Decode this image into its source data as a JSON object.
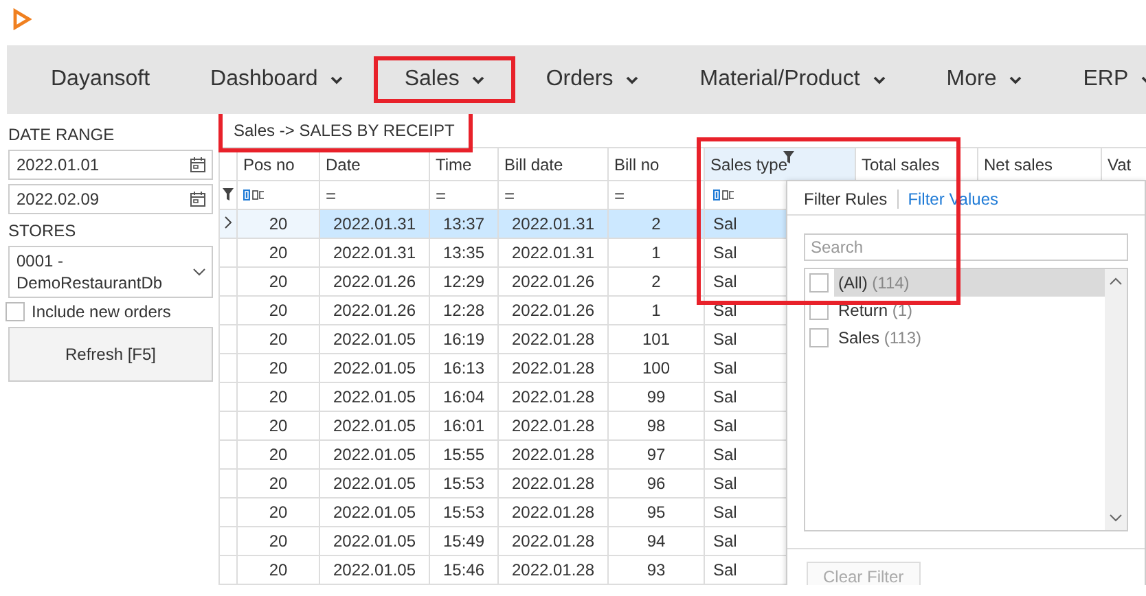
{
  "nav": [
    {
      "label": "Dayansoft",
      "dropdown": false,
      "highlighted": false
    },
    {
      "label": "Dashboard",
      "dropdown": true,
      "highlighted": false
    },
    {
      "label": "Sales",
      "dropdown": true,
      "highlighted": true
    },
    {
      "label": "Orders",
      "dropdown": true,
      "highlighted": false
    },
    {
      "label": "Material/Product",
      "dropdown": true,
      "highlighted": false
    },
    {
      "label": "More",
      "dropdown": true,
      "highlighted": false
    },
    {
      "label": "ERP",
      "dropdown": true,
      "highlighted": false
    }
  ],
  "sidebar": {
    "date_range_label": "DATE RANGE",
    "date_from": "2022.01.01",
    "date_to": "2022.02.09",
    "stores_label": "STORES",
    "store": "0001 - DemoRestaurantDb",
    "include_new_orders": {
      "label": "Include new orders",
      "checked": false
    },
    "refresh_button": "Refresh [F5]"
  },
  "breadcrumb": {
    "text": "Sales -> SALES BY RECEIPT",
    "highlighted": true
  },
  "table": {
    "columns": [
      {
        "label": "Pos no",
        "filter": {
          "kind": "text"
        },
        "highlighted": false
      },
      {
        "label": "Date",
        "filter": {
          "kind": "equals",
          "symbol": "="
        },
        "highlighted": false
      },
      {
        "label": "Time",
        "filter": {
          "kind": "equals",
          "symbol": "="
        },
        "highlighted": false
      },
      {
        "label": "Bill date",
        "filter": {
          "kind": "equals",
          "symbol": "="
        },
        "highlighted": false
      },
      {
        "label": "Bill no",
        "filter": {
          "kind": "equals",
          "symbol": "="
        },
        "highlighted": false
      },
      {
        "label": "Sales type",
        "filter": {
          "kind": "text"
        },
        "highlighted": true,
        "filtered": true
      },
      {
        "label": "Total sales",
        "highlighted": false
      },
      {
        "label": "Net sales",
        "highlighted": false
      },
      {
        "label": "Vat",
        "highlighted": false
      }
    ],
    "rows": [
      {
        "selected": true,
        "cells": [
          "20",
          "2022.01.31",
          "13:37",
          "2022.01.31",
          "2",
          "Sal"
        ]
      },
      {
        "selected": false,
        "cells": [
          "20",
          "2022.01.31",
          "13:35",
          "2022.01.31",
          "1",
          "Sal"
        ]
      },
      {
        "selected": false,
        "cells": [
          "20",
          "2022.01.26",
          "12:29",
          "2022.01.26",
          "2",
          "Sal"
        ]
      },
      {
        "selected": false,
        "cells": [
          "20",
          "2022.01.26",
          "12:28",
          "2022.01.26",
          "1",
          "Sal"
        ]
      },
      {
        "selected": false,
        "cells": [
          "20",
          "2022.01.05",
          "16:19",
          "2022.01.28",
          "101",
          "Sal"
        ]
      },
      {
        "selected": false,
        "cells": [
          "20",
          "2022.01.05",
          "16:13",
          "2022.01.28",
          "100",
          "Sal"
        ]
      },
      {
        "selected": false,
        "cells": [
          "20",
          "2022.01.05",
          "16:04",
          "2022.01.28",
          "99",
          "Sal"
        ]
      },
      {
        "selected": false,
        "cells": [
          "20",
          "2022.01.05",
          "16:01",
          "2022.01.28",
          "98",
          "Sal"
        ]
      },
      {
        "selected": false,
        "cells": [
          "20",
          "2022.01.05",
          "15:55",
          "2022.01.28",
          "97",
          "Sal"
        ]
      },
      {
        "selected": false,
        "cells": [
          "20",
          "2022.01.05",
          "15:53",
          "2022.01.28",
          "96",
          "Sal"
        ]
      },
      {
        "selected": false,
        "cells": [
          "20",
          "2022.01.05",
          "15:53",
          "2022.01.28",
          "95",
          "Sal"
        ]
      },
      {
        "selected": false,
        "cells": [
          "20",
          "2022.01.05",
          "15:49",
          "2022.01.28",
          "94",
          "Sal"
        ]
      },
      {
        "selected": false,
        "cells": [
          "20",
          "2022.01.05",
          "15:46",
          "2022.01.28",
          "93",
          "Sal"
        ]
      }
    ]
  },
  "filter_popup": {
    "tabs": [
      {
        "label": "Filter Rules",
        "selected": false
      },
      {
        "label": "Filter Values",
        "selected": true
      }
    ],
    "search": {
      "placeholder": "Search"
    },
    "values": [
      {
        "label": "(All)",
        "count": "(114)",
        "checked": false,
        "selected": true
      },
      {
        "label": "Return",
        "count": "(1)",
        "checked": false,
        "selected": false
      },
      {
        "label": "Sales",
        "count": "(113)",
        "checked": false,
        "selected": false
      }
    ],
    "clear_button": {
      "label": "Clear Filter",
      "disabled": true
    }
  }
}
